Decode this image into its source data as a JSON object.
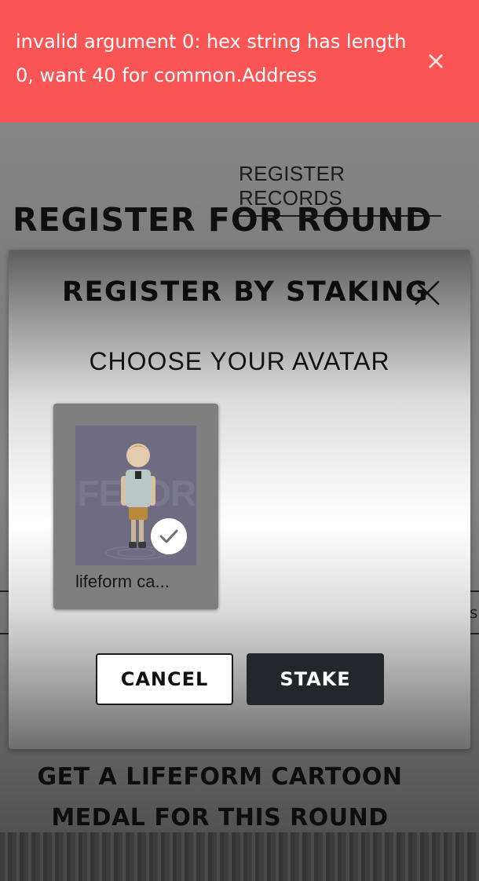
{
  "toast": {
    "message": "invalid argument 0: hex string has length 0, want 40 for common.Address",
    "close_glyph": "×",
    "color": "#fb5454"
  },
  "background_page": {
    "records_link": "REGISTER RECORDS",
    "title": "REGISTER FOR ROUND",
    "medal_text_line1": "GET A LIFEFORM CARTOON",
    "medal_text_line2": "MEDAL FOR THIS ROUND",
    "right_edge_glyph": "s"
  },
  "modal": {
    "title": "REGISTER BY STAKING",
    "close_icon": "close-icon",
    "section_label": "CHOOSE YOUR AVATAR",
    "avatars": [
      {
        "caption": "lifeform ca...",
        "watermark": "LIFEFORM",
        "selected": true
      }
    ],
    "cancel_label": "CANCEL",
    "stake_label": "STAKE",
    "stake_color": "#23262d"
  }
}
